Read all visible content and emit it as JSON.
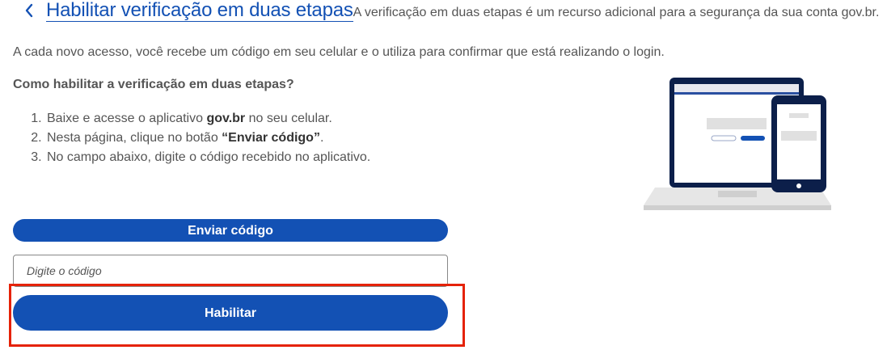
{
  "header": {
    "back_icon": "chevron-left-icon",
    "title": "Habilitar verificação em duas etapas",
    "description_1": "A verificação em duas etapas é um recurso adicional para a segurança da sua conta gov.br.",
    "description_2": "A cada novo acesso, você recebe um código em seu celular e o utiliza para confirmar que está realizando o login."
  },
  "howto": {
    "title": "Como habilitar a verificação em duas etapas?",
    "steps": [
      {
        "before": "Baixe e acesse o aplicativo ",
        "bold": "gov.br",
        "after": " no seu celular."
      },
      {
        "before": "Nesta página, clique no botão ",
        "bold": "“Enviar código”",
        "after": "."
      },
      {
        "before": "No campo abaixo, digite o código recebido no aplicativo.",
        "bold": "",
        "after": ""
      }
    ]
  },
  "illustration": {
    "icon": "laptop-phone-illustration"
  },
  "form": {
    "send_button": "Enviar código",
    "code_placeholder": "Digite o código",
    "code_value": "",
    "enable_button": "Habilitar"
  },
  "colors": {
    "primary": "#1351b4",
    "text": "#555555",
    "highlight": "#e52207"
  }
}
